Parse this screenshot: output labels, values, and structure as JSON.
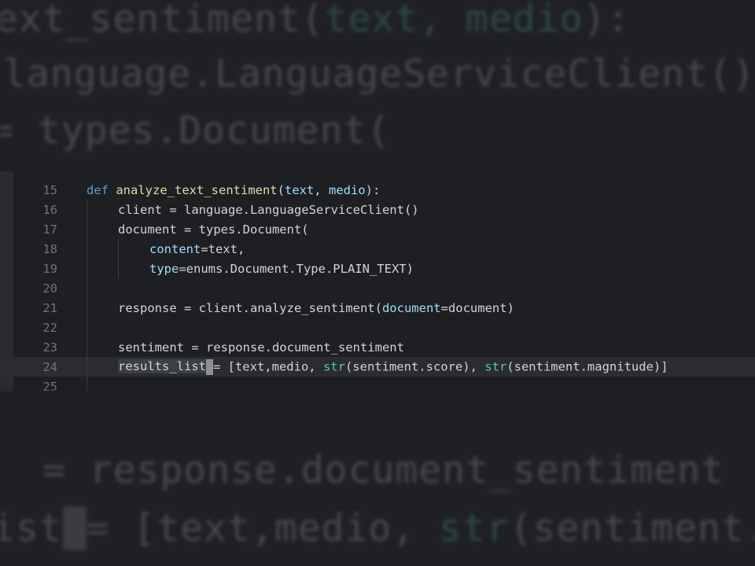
{
  "background_zoom": {
    "top_lines": [
      [
        "ext_sentiment(",
        "text, medio",
        "):"
      ],
      [
        "language.LanguageServiceClient()",
        "",
        ""
      ],
      [
        "= types.Document(",
        "",
        ""
      ]
    ],
    "bottom_lines": [
      [
        " = response.document_sentiment",
        "",
        ""
      ],
      [
        "ist",
        "= [text,medio, ",
        "str",
        "(sentiment."
      ]
    ]
  },
  "editor": {
    "current_line": "24",
    "lines": [
      {
        "number": "15",
        "indent": 0,
        "tokens": [
          {
            "t": "def",
            "k": "keyword"
          },
          {
            "t": " ",
            "k": "plain"
          },
          {
            "t": "analyze_text_sentiment",
            "k": "function"
          },
          {
            "t": "(",
            "k": "plain"
          },
          {
            "t": "text",
            "k": "param"
          },
          {
            "t": ", ",
            "k": "plain"
          },
          {
            "t": "medio",
            "k": "param"
          },
          {
            "t": "):",
            "k": "plain"
          }
        ]
      },
      {
        "number": "16",
        "indent": 1,
        "tokens": [
          {
            "t": "client = language.LanguageServiceClient()",
            "k": "plain"
          }
        ]
      },
      {
        "number": "17",
        "indent": 1,
        "tokens": [
          {
            "t": "document = types.Document(",
            "k": "plain"
          }
        ]
      },
      {
        "number": "18",
        "indent": 2,
        "tokens": [
          {
            "t": "content",
            "k": "param"
          },
          {
            "t": "=text,",
            "k": "plain"
          }
        ]
      },
      {
        "number": "19",
        "indent": 2,
        "tokens": [
          {
            "t": "type",
            "k": "param"
          },
          {
            "t": "=enums.Document.Type.PLAIN_TEXT)",
            "k": "plain"
          }
        ]
      },
      {
        "number": "20",
        "indent": 1,
        "tokens": []
      },
      {
        "number": "21",
        "indent": 1,
        "tokens": [
          {
            "t": "response = client.analyze_sentiment(",
            "k": "plain"
          },
          {
            "t": "document",
            "k": "param"
          },
          {
            "t": "=document)",
            "k": "plain"
          }
        ]
      },
      {
        "number": "22",
        "indent": 1,
        "tokens": []
      },
      {
        "number": "23",
        "indent": 1,
        "tokens": [
          {
            "t": "sentiment = response.document_sentiment",
            "k": "plain"
          }
        ]
      },
      {
        "number": "24",
        "indent": 1,
        "tokens": [
          {
            "t": "results_list",
            "k": "sel"
          },
          {
            "t": "",
            "k": "cursor"
          },
          {
            "t": "= [text,medio, ",
            "k": "plain"
          },
          {
            "t": "str",
            "k": "builtin"
          },
          {
            "t": "(sentiment.score), ",
            "k": "plain"
          },
          {
            "t": "str",
            "k": "builtin"
          },
          {
            "t": "(sentiment.magnitude)]",
            "k": "plain"
          }
        ]
      },
      {
        "number": "25",
        "indent": 0,
        "tokens": []
      }
    ]
  },
  "colors": {
    "background": "#1e1f22",
    "keyword": "#569cd6",
    "function": "#dcdcaa",
    "parameter": "#9cdcfe",
    "builtin": "#4ec9b0",
    "text": "#d4d4d4",
    "line_number": "#6f7378"
  }
}
